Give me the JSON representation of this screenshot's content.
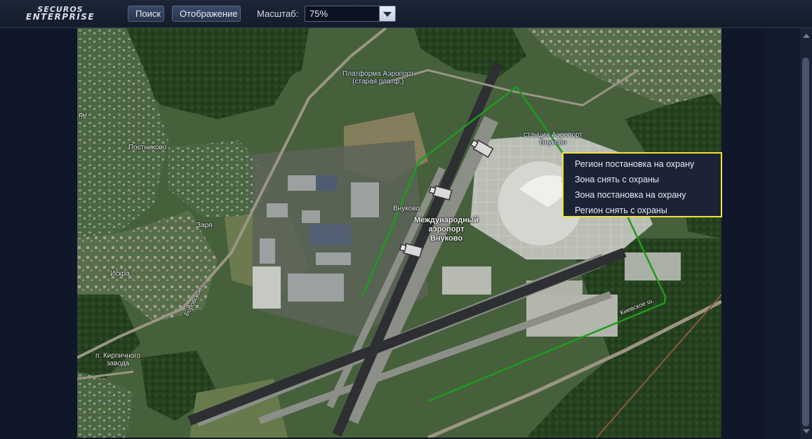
{
  "logo": {
    "line1": "SECUROS",
    "line2": "ENTERPRISE"
  },
  "toolbar": {
    "search_label": "Поиск",
    "display_label": "Отображение",
    "scale_label": "Масштаб:",
    "scale_value": "75%"
  },
  "map": {
    "labels": {
      "postnikovo": "Постниково",
      "zarya": "Заря",
      "iskra": "Искра",
      "platform_line1": "Платформа Аэропорт",
      "platform_line2": "(старая платф.)",
      "station_line1": "станция Аэропорт",
      "station_line2": "Внуково",
      "vnukovo": "Внуково",
      "airport_line1": "Международный",
      "airport_line2": "аэропорт",
      "airport_line3": "Внуково",
      "kirpich_line1": "п. Кирпичного",
      "kirpich_line2": "завода",
      "kievskoe": "Киевское ш.",
      "borovskoe": "Боровское ш.",
      "dy": "ды"
    },
    "region_color": "#1f9a1f",
    "menu_border_color": "#f1e23a"
  },
  "context_menu": {
    "items": [
      {
        "label": "Регион постановка на охрану"
      },
      {
        "label": "Зона снять с охраны"
      },
      {
        "label": "Зона постановка на охрану"
      },
      {
        "label": "Регион снять с охраны"
      }
    ]
  }
}
